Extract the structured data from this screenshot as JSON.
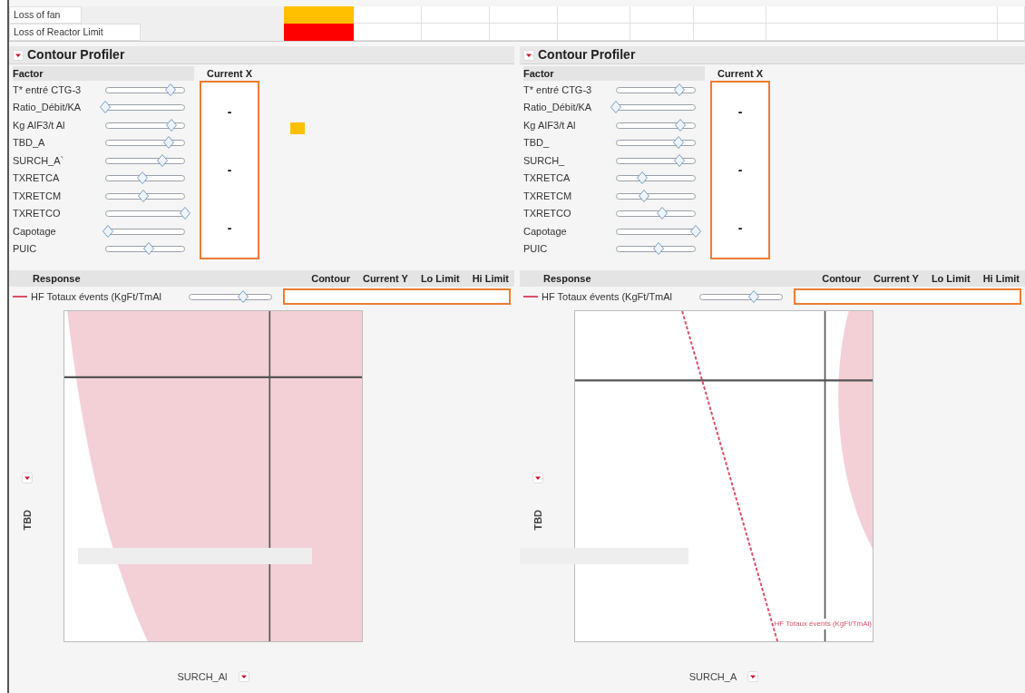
{
  "table": {
    "rows": [
      {
        "label": "Loss of fan",
        "color": "#ffc000"
      },
      {
        "label": "Loss of Reactor Limit",
        "color": "#ff0000"
      }
    ]
  },
  "panels": [
    {
      "title": "Contour Profiler",
      "factor_header": "Factor",
      "current_x_header": "Current X",
      "factors": [
        {
          "name": "T* entré CTG-3",
          "level": 0.82
        },
        {
          "name": "Ratio_Débit/KA",
          "level": 0
        },
        {
          "name": "Kg AIF3/t Al",
          "level": 0.83
        },
        {
          "name": "TBD_A",
          "level": 0.8
        },
        {
          "name": "SURCH_A`",
          "level": 0.72
        },
        {
          "name": "TXRETCA",
          "level": 0.47
        },
        {
          "name": "TXRETCM",
          "level": 0.48
        },
        {
          "name": "TXRETCO",
          "level": 1
        },
        {
          "name": "Capotage",
          "level": 0.03
        },
        {
          "name": "PUIC",
          "level": 0.55
        }
      ],
      "current_x": [
        "-",
        "-",
        "-"
      ],
      "indicator": {
        "color": "#ffc000"
      },
      "response_header": "Response",
      "response_columns": [
        "Contour",
        "Current Y",
        "Lo Limit",
        "Hi Limit"
      ],
      "response": {
        "name": "HF Totaux évents (KgFt/TmAl",
        "level": 0.65
      },
      "plot": {
        "kind": "region"
      },
      "y_axis": "TBD",
      "x_axis": "SURCH_Al"
    },
    {
      "title": "Contour Profiler",
      "factor_header": "Factor",
      "current_x_header": "Current X",
      "factors": [
        {
          "name": "T* entré CTG-3",
          "level": 0.8
        },
        {
          "name": "Ratio_Débit/KA",
          "level": 0
        },
        {
          "name": "Kg AIF3/t Al",
          "level": 0.81
        },
        {
          "name": "TBD_",
          "level": 0.78
        },
        {
          "name": "SURCH_",
          "level": 0.8
        },
        {
          "name": "TXRETCA",
          "level": 0.33
        },
        {
          "name": "TXRETCM",
          "level": 0.35
        },
        {
          "name": "TXRETCO",
          "level": 0.58
        },
        {
          "name": "Capotage",
          "level": 1
        },
        {
          "name": "PUIC",
          "level": 0.53
        }
      ],
      "current_x": [
        "-",
        "-",
        "-"
      ],
      "response_header": "Response",
      "response_columns": [
        "Contour",
        "Current Y",
        "Lo Limit",
        "Hi Limit"
      ],
      "response": {
        "name": "HF Totaux évents (KgFt/TmAl",
        "level": 0.65
      },
      "plot": {
        "kind": "line",
        "contour_label": "HF Totaux évents (KgFt/TmAl)"
      },
      "y_axis": "TBD",
      "x_axis": "SURCH_A"
    }
  ]
}
